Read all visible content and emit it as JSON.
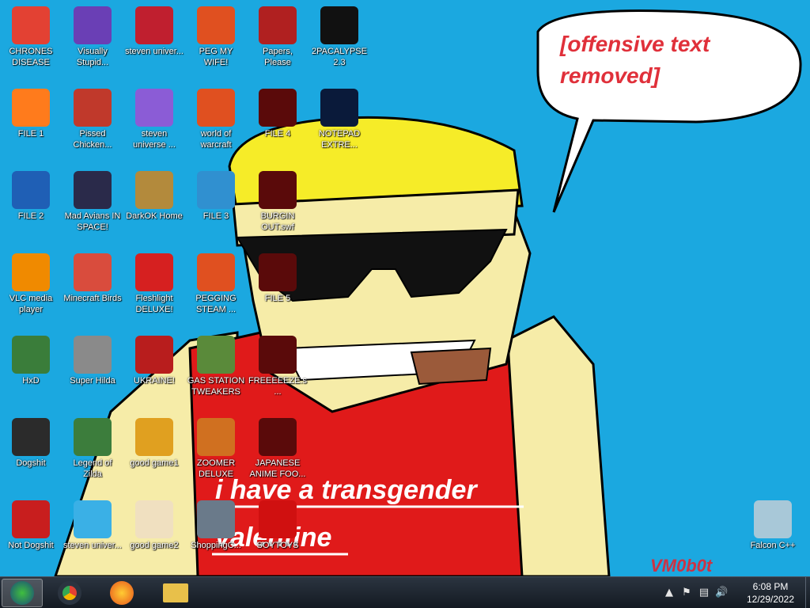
{
  "wallpaper": {
    "bubble_text": "[offensive text removed]",
    "shirt_line1": "i have a transgender",
    "shirt_line2": "valentine",
    "signature": "VM0b0t"
  },
  "icons": [
    {
      "label": "CHRONES DISEASE",
      "icon": "chrome-icon",
      "color": "#e34133"
    },
    {
      "label": "FILE 1",
      "icon": "firefox-icon",
      "color": "#ff7b1c"
    },
    {
      "label": "FILE 2",
      "icon": "obama-logo-icon",
      "color": "#1f5fb5"
    },
    {
      "label": "VLC media player",
      "icon": "vlc-icon",
      "color": "#f08a00"
    },
    {
      "label": "HxD",
      "icon": "hxd-icon",
      "color": "#3a7d3a"
    },
    {
      "label": "Dogshit",
      "icon": "dogshit-icon",
      "color": "#2b2b2b"
    },
    {
      "label": "Not Dogshit",
      "icon": "devcpp-icon",
      "color": "#c81e1e"
    },
    {
      "label": "Visually Stupid...",
      "icon": "visual-studio-icon",
      "color": "#6a3fb5"
    },
    {
      "label": "Pissed Chicken...",
      "icon": "angry-birds-icon",
      "color": "#c0392b"
    },
    {
      "label": "Mad Avians IN SPACE!",
      "icon": "angry-birds-space-icon",
      "color": "#2a2a4a"
    },
    {
      "label": "Minecraft Birds",
      "icon": "angry-birds-icon",
      "color": "#d94c3d"
    },
    {
      "label": "Super Hilda",
      "icon": "pixel-art-icon",
      "color": "#8a8a8a"
    },
    {
      "label": "Legend of Zilda",
      "icon": "character-icon",
      "color": "#3c7d3c"
    },
    {
      "label": "steven univer...",
      "icon": "diamond-icon",
      "color": "#3ab0e6"
    },
    {
      "label": "steven univer...",
      "icon": "game-icon",
      "color": "#c01f2f"
    },
    {
      "label": "steven universe ...",
      "icon": "gem-icon",
      "color": "#8b5cd6"
    },
    {
      "label": "DarkOK Home",
      "icon": "money-bag-icon",
      "color": "#b38a3c"
    },
    {
      "label": "Fleshlight DELUXE!",
      "icon": "red-ball-icon",
      "color": "#d62020"
    },
    {
      "label": "UKRAINE!",
      "icon": "radiation-icon",
      "color": "#b81d1d"
    },
    {
      "label": "good game1",
      "icon": "mahjong-icon",
      "color": "#e0a020"
    },
    {
      "label": "good game2",
      "icon": "mahjong-icon",
      "color": "#f0e0c0"
    },
    {
      "label": "PEG MY WIFE!",
      "icon": "p-logo-icon",
      "color": "#e05020"
    },
    {
      "label": "world of warcraft",
      "icon": "p-logo-icon",
      "color": "#e05020"
    },
    {
      "label": "FILE 3",
      "icon": "p-logo-icon",
      "color": "#3090d0"
    },
    {
      "label": "PEGGING STEAM ...",
      "icon": "p-logo-icon",
      "color": "#e05020"
    },
    {
      "label": "GAS STATION TWEAKERS",
      "icon": "plant-icon",
      "color": "#5a8a3a"
    },
    {
      "label": "ZOOMER DELUXE",
      "icon": "idol-icon",
      "color": "#d07020"
    },
    {
      "label": "ShoppingC...",
      "icon": "flash-icon",
      "color": "#6a7a8a"
    },
    {
      "label": "Papers, Please",
      "icon": "eagle-icon",
      "color": "#b02020"
    },
    {
      "label": "FILE 4",
      "icon": "flash-icon",
      "color": "#5a0a0a"
    },
    {
      "label": "BURGIN OUT.swf",
      "icon": "flash-icon",
      "color": "#5a0a0a"
    },
    {
      "label": "FILE 5",
      "icon": "flash-icon",
      "color": "#5a0a0a"
    },
    {
      "label": "FREEEEEZE.s...",
      "icon": "flash-icon",
      "color": "#5a0a0a"
    },
    {
      "label": "JAPANESE ANIME FOO...",
      "icon": "flash-icon",
      "color": "#5a0a0a"
    },
    {
      "label": "SOYTOYS",
      "icon": "s-logo-icon",
      "color": "#d01010"
    },
    {
      "label": "2PACALYPSE 2.3",
      "icon": "terminal-icon",
      "color": "#111111"
    },
    {
      "label": "NOTEPAD EXTRE...",
      "icon": "notepad-icon",
      "color": "#0a1a3a"
    },
    {
      "label": "Falcon C++",
      "icon": "recycle-bin-icon",
      "color": "#a8c8d8"
    }
  ],
  "taskbar": {
    "start_icon": "start-orb-icon",
    "pinned": [
      {
        "name": "chrome",
        "icon": "chrome-icon",
        "color": "#e34133"
      },
      {
        "name": "firefox",
        "icon": "firefox-icon",
        "color": "#ff7b1c"
      },
      {
        "name": "explorer",
        "icon": "folder-icon",
        "color": "#e8c04a"
      }
    ],
    "time": "6:08 PM",
    "date": "12/29/2022"
  }
}
